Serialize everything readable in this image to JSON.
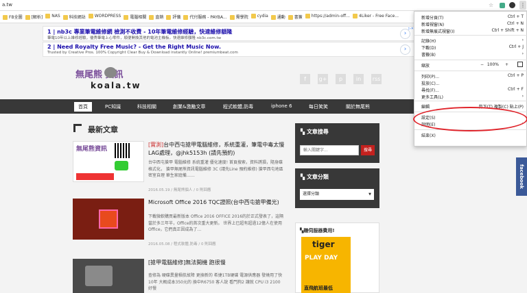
{
  "window": {
    "url": "a.tw"
  },
  "bookmarks": [
    "FB全圖",
    "[解析]",
    "NAS",
    "科技網站",
    "WORDPRESS",
    "電腦相關",
    "直銷",
    "評儀",
    "代付服務 - PAYBA...",
    "需學院",
    "cydia",
    "通動",
    "書簽",
    "https://admin-off...",
    "4Liker - Free Face..."
  ],
  "ads": [
    {
      "num": "1",
      "title": "nb3c 專業筆電維修網 檢測不收費 - 10年筆電維修經驗，快速維修額隆",
      "sub": "筆電10年以上維修經驗，優秀筆電上心零件，順便開換其他的電池主機板。快速維修額隆 nb3c.com.tw"
    },
    {
      "num": "2",
      "title": "Need Royalty Free Music? - Get the Right Music Now.",
      "sub": "Trusted by Creative Pros. 100% Copyright Clear Buy & Download instantly Online! premiumbeat.com"
    }
  ],
  "logo": {
    "text_top": "無尾熊  資訊",
    "text_bottom": "koala.tw"
  },
  "social": [
    "f",
    "g+",
    "p",
    "in",
    "rss"
  ],
  "nav": [
    "首頁",
    "PC知識",
    "科技相關",
    "創業&激勵文章",
    "程式軟體,防毒",
    "iphone 6",
    "每日笑笑",
    "關於無尾熊"
  ],
  "section_title": "最新文章",
  "posts": [
    {
      "tag": "[實測]",
      "title": "台中西屯搶甲電腦維修，系統重灌，筆電中毒太慢LAG處理，@jhk5153h (請先預約)",
      "body": "台中西屯搶甲 電腦維修 系統重灌 優化速度! 首頁搜索，資料誘損，隨身碟格式化，  搶甲無尾熊資訊電腦維修 3C (請先Line 預約維修) 搶甲西屯地區  密室自理 華生家庭備……",
      "meta": "2016.05.19 / 無尾熊個人 / 0 則回應"
    },
    {
      "tag": "",
      "title": "Microsoft Office 2016 TQC證照(台中西屯搶甲備光)",
      "body": "下載微軟購買最新版本 Office 2016 OFFICE 2016的於正式發表了，這隔當於多三年半，Office的首次重大更新。 世界上已超有超過12億人在使用Office，它們真正因成為了…",
      "meta": "2016.05.08 / 程式軟體,防毒 / 0 則回應"
    },
    {
      "tag": "",
      "title": "[搶甲電腦維修]無法開機 跑很慢",
      "body": "查修為 硬碟異量積航故障 更換新的 希捷1TB硬碟 電源供應器 發燒用了快10年  大概成本350元的 換中R6750  客人說 看門狗2 讓就 CPU i3 2100 好慢",
      "meta": ""
    }
  ],
  "sidebar": {
    "search_title": "文章搜尋",
    "search_placeholder": "輸入關鍵字...",
    "search_button": "搜尋",
    "category_title": "文章分類",
    "category_select": "選擇分類",
    "server_title": "賺伺服器費用!",
    "ad_text1": "tiger",
    "ad_text2": "PLAY DAY",
    "ad_text3": "直飛航班最低"
  },
  "menu": {
    "items": [
      {
        "label": "新增分頁(T)",
        "key": "Ctrl + T"
      },
      {
        "label": "新增視窗(N)",
        "key": "Ctrl + N"
      },
      {
        "label": "新增無痕式視窗(I)",
        "key": "Ctrl + Shift + N"
      },
      {
        "label": "記錄(H)",
        "key": "›"
      },
      {
        "label": "下載(D)",
        "key": "Ctrl + J"
      },
      {
        "label": "書籤(B)",
        "key": "›"
      },
      {
        "label": "縮放",
        "key": "100%"
      },
      {
        "label": "列印(P)...",
        "key": "Ctrl + P"
      },
      {
        "label": "投放(C)...",
        "key": ""
      },
      {
        "label": "尋找(F)...",
        "key": "Ctrl + F"
      },
      {
        "label": "更多工具(L)",
        "key": "›"
      },
      {
        "label": "編輯",
        "key": "剪下(T)   複製(C)   貼上(P)"
      },
      {
        "label": "設定(S)",
        "key": ""
      },
      {
        "label": "說明(E)",
        "key": "›"
      },
      {
        "label": "結束(X)",
        "key": ""
      }
    ]
  },
  "facebook_tab": "facebook"
}
